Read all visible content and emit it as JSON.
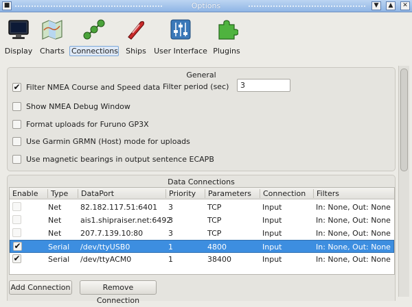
{
  "window": {
    "title": "Options",
    "menu_glyph": "■",
    "min_glyph": "▼",
    "max_glyph": "▲",
    "close_glyph": "✕"
  },
  "toolbar": {
    "items": [
      {
        "label": "Display",
        "icon": "monitor-icon",
        "active": false
      },
      {
        "label": "Charts",
        "icon": "chart-map-icon",
        "active": false
      },
      {
        "label": "Connections",
        "icon": "connections-icon",
        "active": true
      },
      {
        "label": "Ships",
        "icon": "ship-icon",
        "active": false
      },
      {
        "label": "User Interface",
        "icon": "sliders-icon",
        "active": false
      },
      {
        "label": "Plugins",
        "icon": "puzzle-icon",
        "active": false
      }
    ]
  },
  "general": {
    "title": "General",
    "filter_nmea": {
      "label": "Filter NMEA Course and Speed data",
      "checked": true
    },
    "filter_period_label": "Filter period (sec)",
    "filter_period_value": "3",
    "options": [
      {
        "label": "Show NMEA Debug Window",
        "checked": false
      },
      {
        "label": "Format uploads for Furuno GP3X",
        "checked": false
      },
      {
        "label": "Use Garmin GRMN (Host) mode for uploads",
        "checked": false
      },
      {
        "label": "Use magnetic bearings in output sentence ECAPB",
        "checked": false
      }
    ]
  },
  "data_connections": {
    "title": "Data Connections",
    "columns": [
      "Enable",
      "Type",
      "DataPort",
      "Priority",
      "Parameters",
      "Connection",
      "Filters"
    ],
    "rows": [
      {
        "enabled": false,
        "type": "Net",
        "dataport": "82.182.117.51:6401",
        "priority": "3",
        "parameters": "TCP",
        "connection": "Input",
        "filters": "In: None, Out: None",
        "selected": false
      },
      {
        "enabled": false,
        "type": "Net",
        "dataport": "ais1.shipraiser.net:6492",
        "priority": "3",
        "parameters": "TCP",
        "connection": "Input",
        "filters": "In: None, Out: None",
        "selected": false
      },
      {
        "enabled": false,
        "type": "Net",
        "dataport": "207.7.139.10:80",
        "priority": "3",
        "parameters": "TCP",
        "connection": "Input",
        "filters": "In: None, Out: None",
        "selected": false
      },
      {
        "enabled": true,
        "type": "Serial",
        "dataport": "/dev/ttyUSB0",
        "priority": "1",
        "parameters": "4800",
        "connection": "Input",
        "filters": "In: None, Out: None",
        "selected": true
      },
      {
        "enabled": true,
        "type": "Serial",
        "dataport": "/dev/ttyACM0",
        "priority": "1",
        "parameters": "38400",
        "connection": "Input",
        "filters": "In: None, Out: None",
        "selected": false
      }
    ],
    "add_button": "Add Connection",
    "remove_button": "Remove Connection"
  },
  "check_glyph": "✔"
}
